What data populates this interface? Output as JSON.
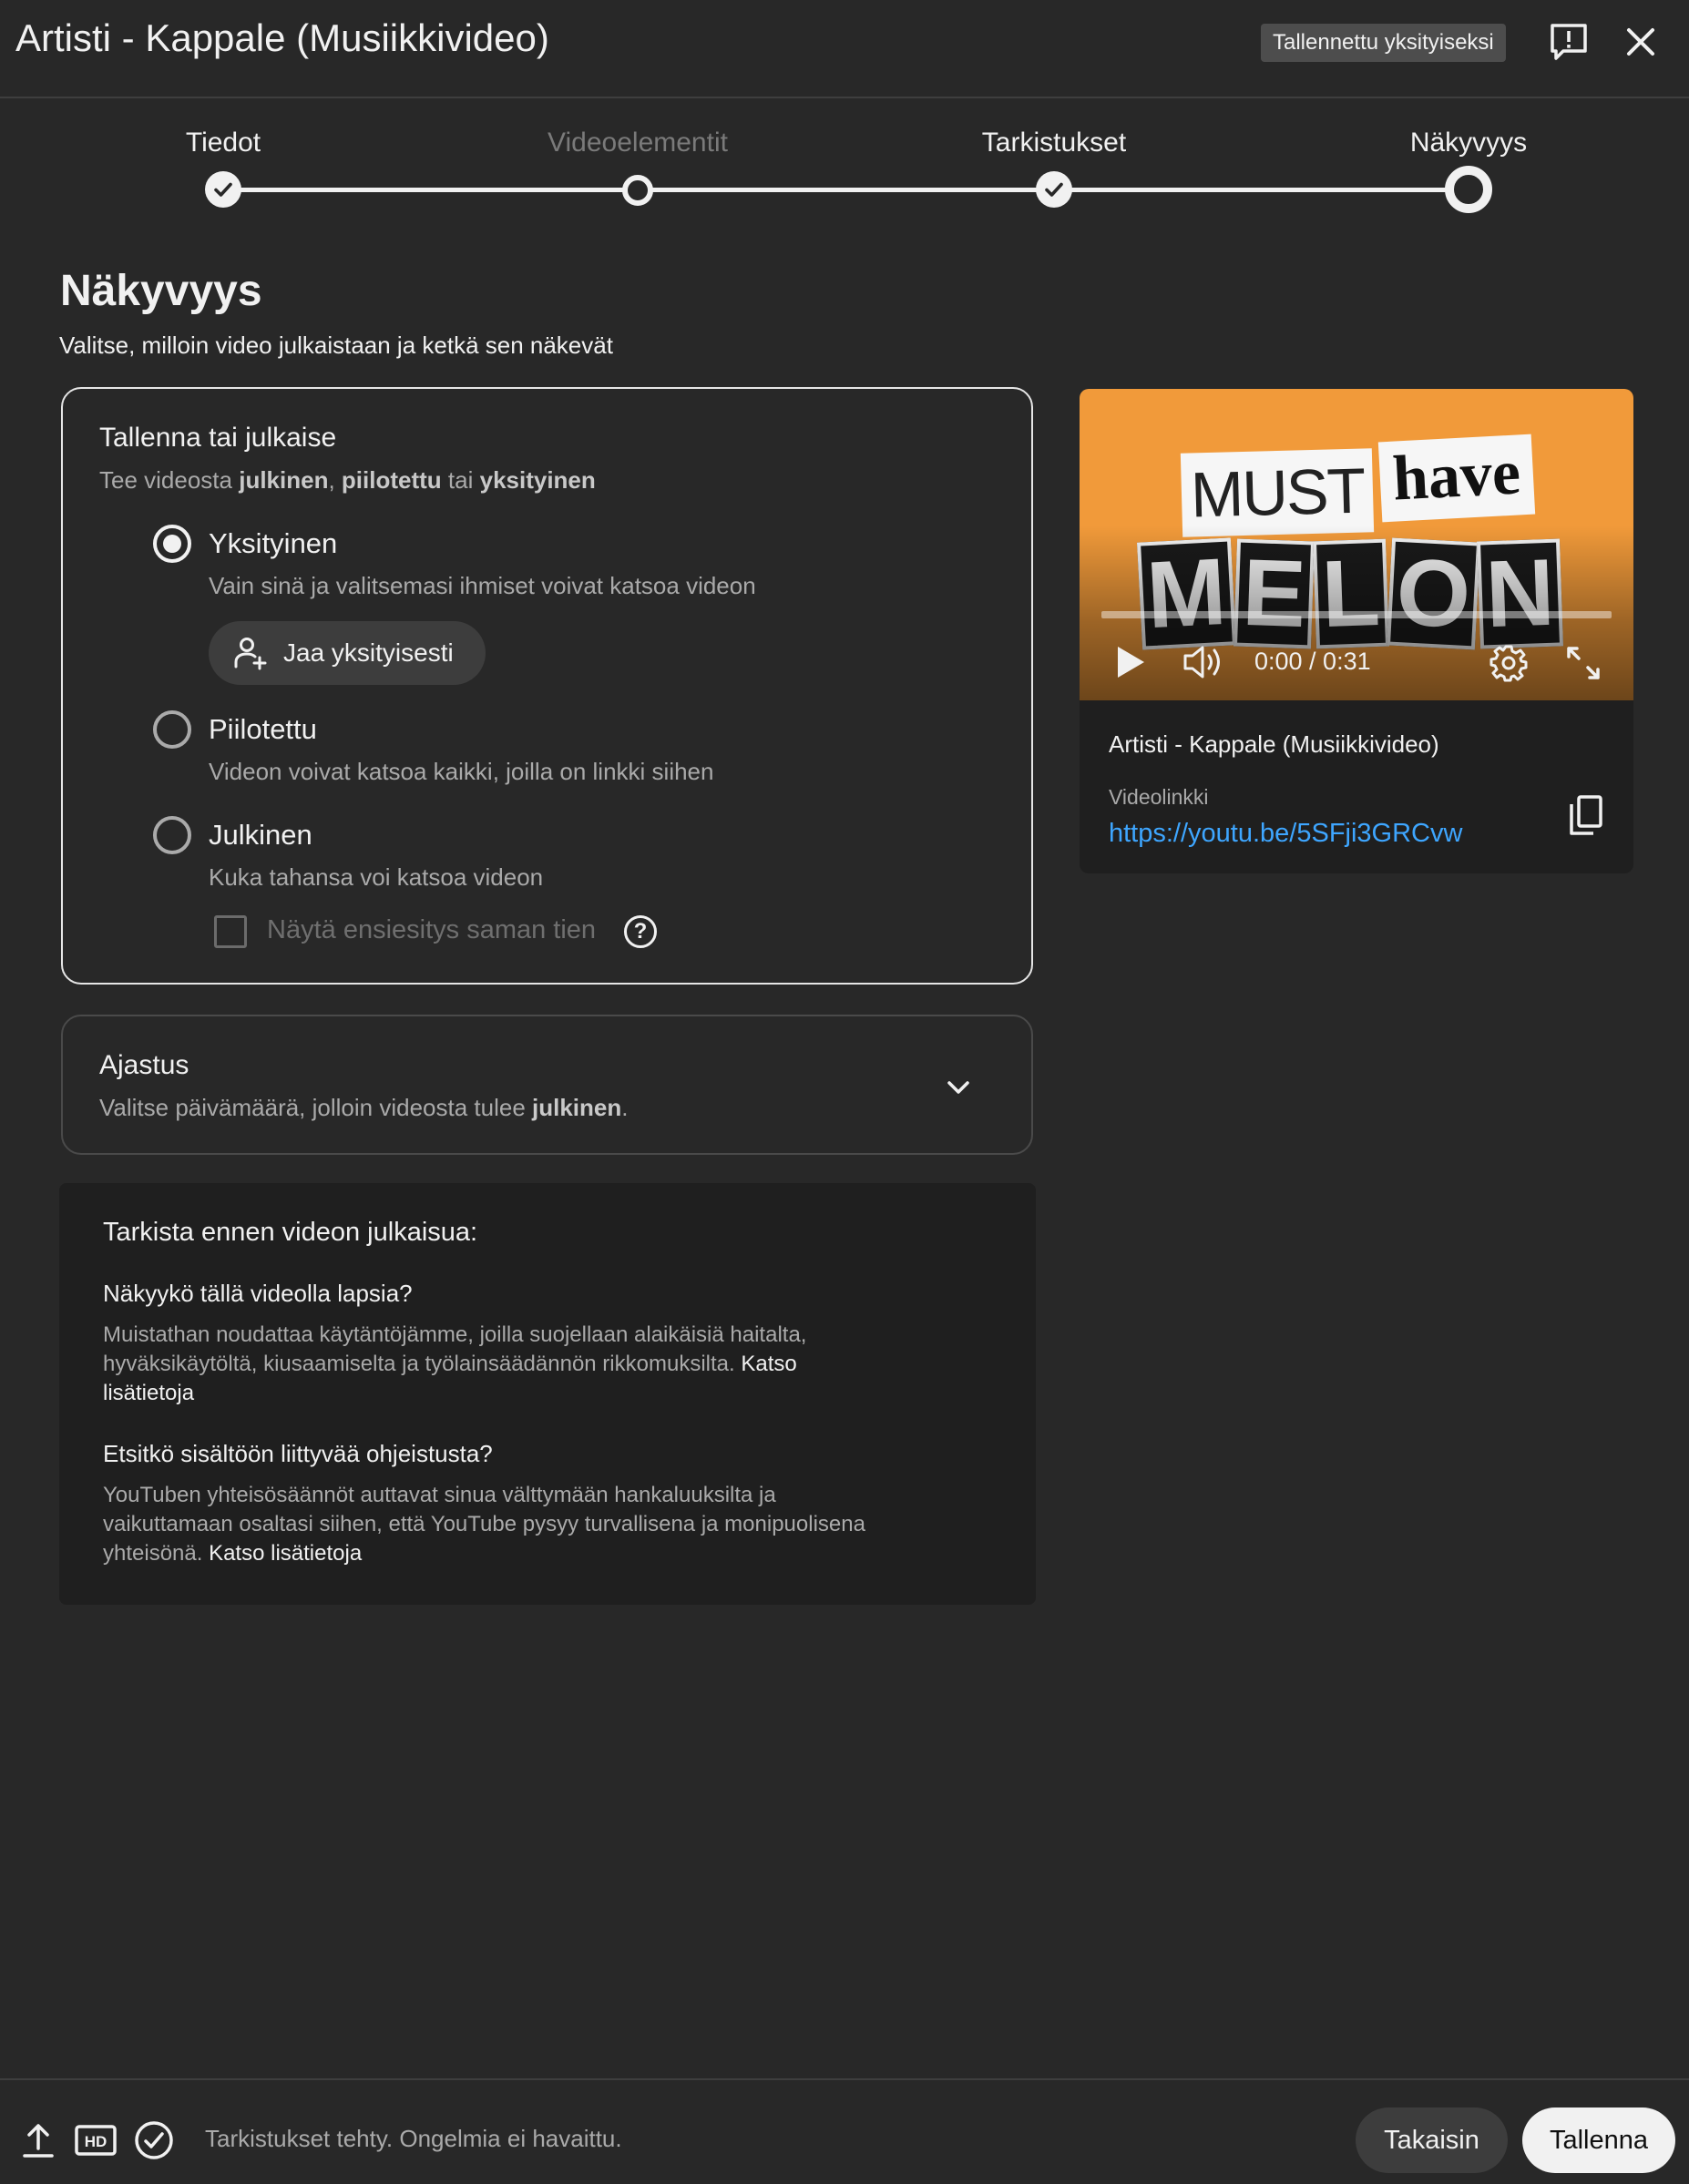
{
  "header": {
    "title": "Artisti - Kappale (Musiikkivideo)",
    "saved_badge": "Tallennettu yksityiseksi",
    "feedback_icon": "feedback-icon",
    "close_icon": "close-icon"
  },
  "stepper": {
    "steps": [
      {
        "label": "Tiedot",
        "state": "done"
      },
      {
        "label": "Videoelementit",
        "state": "skipped"
      },
      {
        "label": "Tarkistukset",
        "state": "done"
      },
      {
        "label": "Näkyvyys",
        "state": "current"
      }
    ]
  },
  "visibility": {
    "title": "Näkyvyys",
    "subtitle": "Valitse, milloin video julkaistaan ja ketkä sen näkevät"
  },
  "save_publish": {
    "title": "Tallenna tai julkaise",
    "subtitle_prefix": "Tee videosta ",
    "subtitle_public": "julkinen",
    "subtitle_sep1": ", ",
    "subtitle_unlisted": "piilotettu",
    "subtitle_sep2": " tai ",
    "subtitle_private": "yksityinen",
    "options": [
      {
        "label": "Yksityinen",
        "desc": "Vain sinä ja valitsemasi ihmiset voivat katsoa videon",
        "selected": true
      },
      {
        "label": "Piilotettu",
        "desc": "Videon voivat katsoa kaikki, joilla on linkki siihen",
        "selected": false
      },
      {
        "label": "Julkinen",
        "desc": "Kuka tahansa voi katsoa videon",
        "selected": false
      }
    ],
    "share_privately": "Jaa yksityisesti",
    "premiere_label": "Näytä ensiesitys saman tien",
    "premiere_checked": false,
    "help_glyph": "?"
  },
  "schedule": {
    "title": "Ajastus",
    "desc_prefix": "Valitse päivämäärä, jolloin videosta tulee ",
    "desc_bold": "julkinen",
    "desc_suffix": "."
  },
  "checklist": {
    "title": "Tarkista ennen videon julkaisua:",
    "q1": "Näkyykö tällä videolla lapsia?",
    "a1": "Muistathan noudattaa käytäntöjämme, joilla suojellaan alaikäisiä haitalta, hyväksikäytöltä, kiusaamiselta ja työlainsäädännön rikkomuksilta.",
    "a1_link": "Katso lisätietoja",
    "q2": "Etsitkö sisältöön liittyvää ohjeistusta?",
    "a2": "YouTuben yhteisösäännöt auttavat sinua välttymään hankaluuksilta ja vaikuttamaan osaltasi siihen, että YouTube pysyy turvallisena ja monipuolisena yhteisönä.",
    "a2_link": "Katso lisätietoja"
  },
  "preview": {
    "thumbnail_text": {
      "line1": "MUST",
      "line2": "have",
      "line3": [
        "M",
        "E",
        "L",
        "O",
        "N"
      ]
    },
    "time": "0:00 / 0:31",
    "progress": 0,
    "video_title": "Artisti - Kappale (Musiikkivideo)",
    "link_label": "Videolinkki",
    "link": "https://youtu.be/5SFji3GRCvw"
  },
  "footer": {
    "status": "Tarkistukset tehty. Ongelmia ei havaittu.",
    "back": "Takaisin",
    "save": "Tallenna",
    "hd_label": "HD"
  },
  "colors": {
    "background": "#282828",
    "text": "#f1f1f1",
    "muted": "#aaaaaa",
    "link": "#3ea6ff",
    "thumbnail": "#f19a3a"
  }
}
